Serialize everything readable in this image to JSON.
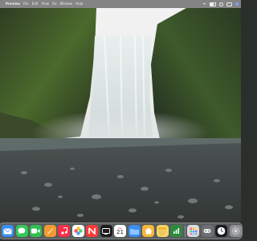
{
  "menubar": {
    "apple": "",
    "app_name": "Preview",
    "menu_items": [
      "File",
      "Edit",
      "View",
      "Go",
      "Window",
      "Help"
    ],
    "status_icons": [
      "wifi-icon",
      "battery-icon",
      "search-icon",
      "control-center-icon",
      "siri-icon"
    ]
  },
  "wallpaper": {
    "subject": "waterfall"
  },
  "dock": {
    "calendar_month": "JUL",
    "calendar_day": "21",
    "apps": [
      {
        "name": "mail",
        "color": "#3a8ef0"
      },
      {
        "name": "messages",
        "color": "#34c759"
      },
      {
        "name": "facetime",
        "color": "#2fbf4f"
      },
      {
        "name": "pages",
        "color": "#f29b30"
      },
      {
        "name": "music",
        "color": "#fa2d48"
      },
      {
        "name": "photos",
        "color": "#ffffff"
      },
      {
        "name": "news",
        "color": "#ff3b3b"
      },
      {
        "name": "tv",
        "color": "#1c1c1e"
      },
      {
        "name": "calendar",
        "color": "#ffffff"
      },
      {
        "name": "finder-folder",
        "color": "#3d8ef0"
      },
      {
        "name": "home",
        "color": "#f6b73c"
      },
      {
        "name": "notes",
        "color": "#f7d36b"
      },
      {
        "name": "numbers",
        "color": "#2c8a3f"
      },
      {
        "name": "launchpad",
        "color": "#d9dde3"
      },
      {
        "name": "game-center",
        "color": "#6c6f74"
      },
      {
        "name": "clock",
        "color": "#1c1c1e"
      },
      {
        "name": "system-settings",
        "color": "#8e8e93"
      }
    ]
  }
}
